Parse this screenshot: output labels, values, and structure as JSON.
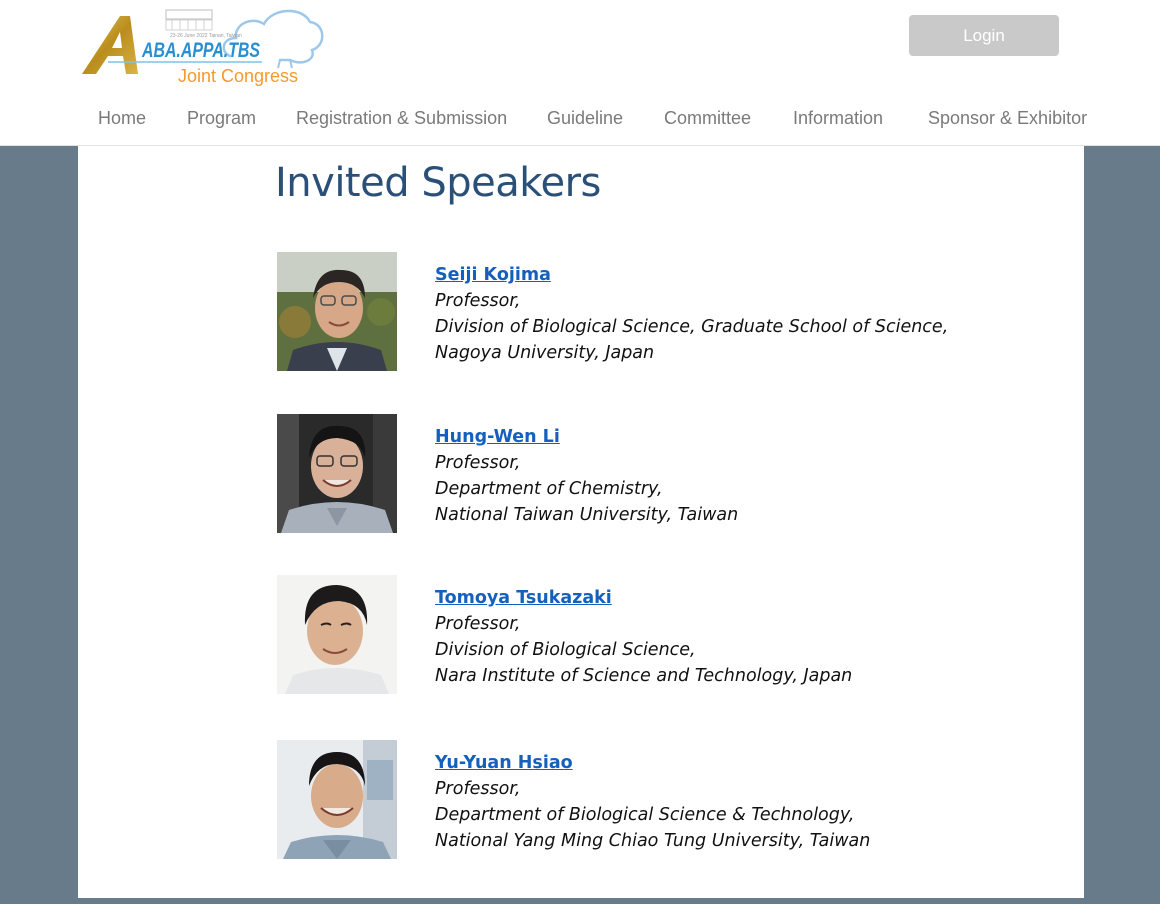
{
  "logo": {
    "line1": "ABA.APPA.TBS",
    "line2": "Joint Congress",
    "small_text": "23-26 June 2022 Tainan, Taiwan"
  },
  "header": {
    "login_label": "Login"
  },
  "nav": {
    "items": [
      {
        "label": "Home"
      },
      {
        "label": "Program"
      },
      {
        "label": "Registration & Submission"
      },
      {
        "label": "Guideline"
      },
      {
        "label": "Committee"
      },
      {
        "label": "Information"
      },
      {
        "label": "Sponsor & Exhibitor"
      }
    ]
  },
  "main": {
    "title": "Invited Speakers",
    "speakers": [
      {
        "name": "Seiji Kojima",
        "lines": [
          "Professor,",
          "Division of Biological Science, Graduate School of Science,",
          "Nagoya University, Japan"
        ]
      },
      {
        "name": "Hung-Wen Li",
        "lines": [
          "Professor,",
          "Department of Chemistry,",
          "National Taiwan University, Taiwan"
        ]
      },
      {
        "name": "Tomoya Tsukazaki",
        "lines": [
          "Professor,",
          "Division of Biological Science,",
          "Nara Institute of Science and Technology, Japan"
        ]
      },
      {
        "name": "Yu-Yuan Hsiao",
        "lines": [
          "Professor,",
          "Department of Biological Science & Technology,",
          "National Yang Ming Chiao Tung University, Taiwan"
        ]
      }
    ]
  },
  "colors": {
    "title": "#2a5078",
    "link": "#1560bd",
    "side_panel": "#687b8b",
    "login_button": "#c9c9c9",
    "nav_text": "#7a7a7a",
    "logo_gold": "#c9a227",
    "logo_blue": "#2a8fd0",
    "logo_orange": "#f39a2d"
  }
}
